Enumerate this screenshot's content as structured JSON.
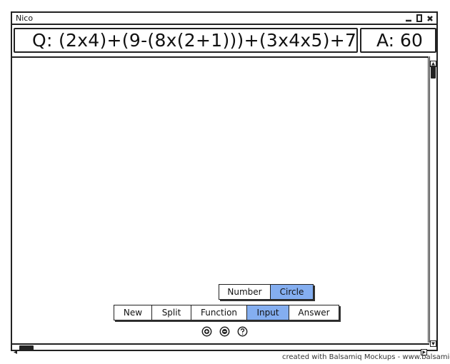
{
  "window": {
    "title": "Nico"
  },
  "problem": {
    "question": "Q: (2x4)+(9-(8x(2+1)))+(3x4x5)+7",
    "answer": "A: 60"
  },
  "toolbar_top": [
    {
      "label": "Number",
      "selected": false
    },
    {
      "label": "Circle",
      "selected": true
    }
  ],
  "toolbar_bottom": [
    {
      "label": "New",
      "selected": false
    },
    {
      "label": "Split",
      "selected": false
    },
    {
      "label": "Function",
      "selected": false
    },
    {
      "label": "Input",
      "selected": true
    },
    {
      "label": "Answer",
      "selected": false
    }
  ],
  "icons": [
    "zoom-in-icon",
    "zoom-out-icon",
    "help-icon"
  ],
  "colors": {
    "selected": "#84aef0",
    "border": "#222222"
  },
  "footer": {
    "text": "created with Balsamiq Mockups - www.balsamiq.com"
  }
}
